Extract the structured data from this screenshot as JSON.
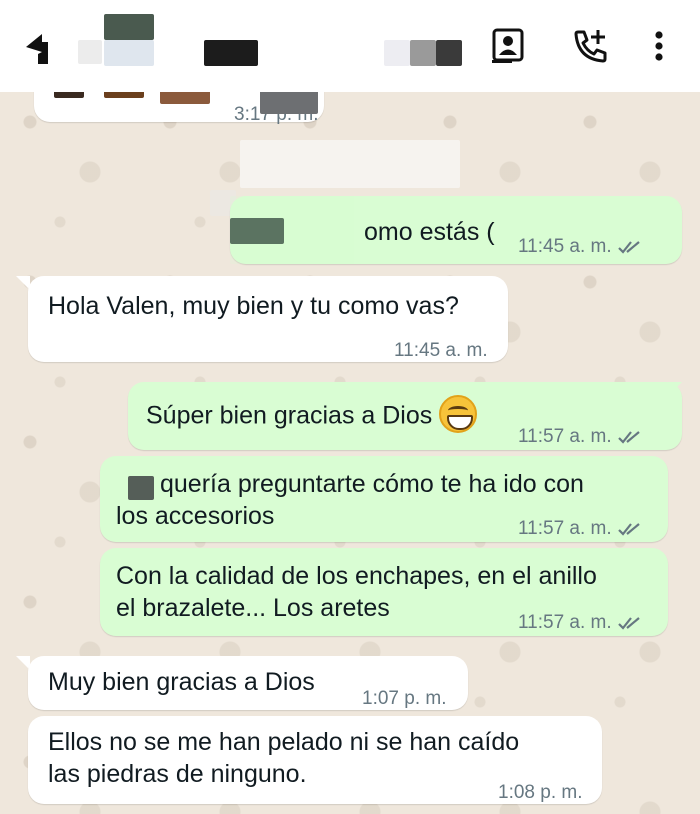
{
  "header": {
    "back_icon": "arrow-back-icon",
    "video_icon": "contact-card-icon",
    "call_icon": "add-call-icon",
    "menu_icon": "more-vert-icon"
  },
  "messages": [
    {
      "dir": "in",
      "text": "",
      "time": "3:17 p. m.",
      "partial": true
    },
    {
      "dir": "out",
      "text": "omo estás (",
      "time": "11:45 a. m.",
      "read": true
    },
    {
      "dir": "in",
      "text": "Hola Valen, muy bien y tu como vas?",
      "time": "11:45 a. m."
    },
    {
      "dir": "out",
      "text": "Súper bien gracias a Dios",
      "emoji": "grinning-face-emoji",
      "time": "11:57 a. m.",
      "read": true
    },
    {
      "dir": "out",
      "line1": "quería preguntarte cómo te ha ido con",
      "line2": "los accesorios",
      "time": "11:57 a. m.",
      "read": true
    },
    {
      "dir": "out",
      "line1": "Con la calidad de los enchapes, en el anillo",
      "line2": "el brazalete... Los aretes",
      "time": "11:57 a. m.",
      "read": true
    },
    {
      "dir": "in",
      "text": "Muy bien gracias a Dios",
      "time": "1:07 p. m."
    },
    {
      "dir": "in",
      "line1": "Ellos no se me han pelado ni se han caído",
      "line2": "las piedras de ninguno.",
      "time": "1:08 p. m."
    }
  ],
  "colors": {
    "outgoing_bubble": "#d9fdd3",
    "incoming_bubble": "#ffffff",
    "read_ticks": "#667781",
    "wallpaper": "#efe7dc"
  }
}
